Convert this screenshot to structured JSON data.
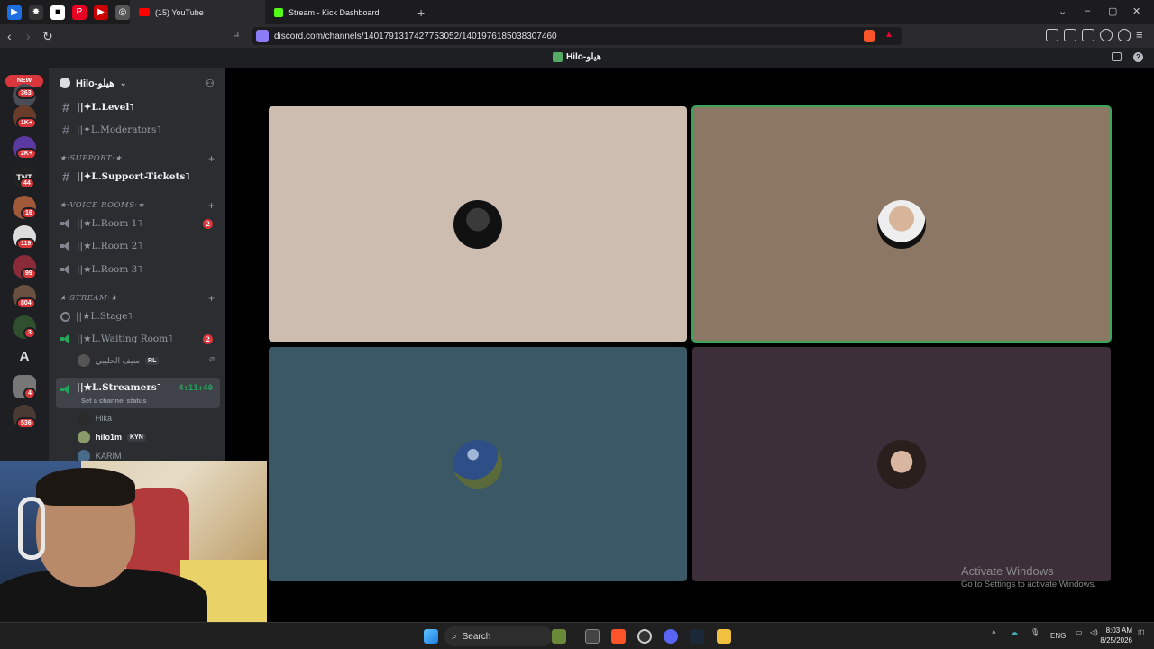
{
  "browser": {
    "tabs": [
      {
        "label": "(15) YouTube",
        "favicon": "youtube-icon",
        "active": true
      },
      {
        "label": "Stream - Kick Dashboard",
        "favicon": "kick-icon",
        "active": false
      }
    ],
    "new_tab": "+",
    "url": "discord.com/channels/1401791317427753052/1401976185038307460"
  },
  "discord": {
    "window_title": "Hilo-هيلو",
    "rail": {
      "new_label": "NEW",
      "badges": [
        "363",
        "1K+",
        "2K+",
        "44",
        "16",
        "119",
        "99",
        "804",
        "3",
        "4",
        "536"
      ]
    },
    "guild_name": "Hilo-هيلو",
    "channels": {
      "level": "||✦L.Level˥",
      "moderators": "||✦L.Moderators˥",
      "support_category": "★·SUPPORT·★",
      "support_tickets": "||✦L.Support-Tickets˥",
      "voice_category": "★·VOICE ROOMS·★",
      "room1": "||★L.Room 1˥",
      "room1_badge": "2",
      "room2": "||★L.Room 2˥",
      "room3": "||★L.Room 3˥",
      "stream_category": "★·STREAM·★",
      "stage": "||★L.Stage˥",
      "waiting_room": "||★L.Waiting Room˥",
      "waiting_badge": "2",
      "waiting_user": "سيف الحليبي",
      "waiting_user_tag": "RL",
      "streamers": "||★L.Streamers˥",
      "streamers_timer": "4:11:40",
      "streamers_status": "Set a channel status",
      "voice_users": [
        {
          "name": "Hika",
          "tag": ""
        },
        {
          "name": "hilo1m",
          "tag": "KYN"
        },
        {
          "name": "KARIM",
          "tag": ""
        }
      ]
    }
  },
  "stage_tiles": [
    {
      "color": "#cdbcb0",
      "avatar": "man-in-suit-sunglasses"
    },
    {
      "color": "#8b7763",
      "avatar": "bald-man-suit",
      "speaking": true
    },
    {
      "color": "#3b5866",
      "avatar": "starry-night-painting"
    },
    {
      "color": "#3d2f3a",
      "avatar": "young-man-photo"
    }
  ],
  "watermark": {
    "line1": "Activate Windows",
    "line2": "Go to Settings to activate Windows."
  },
  "taskbar": {
    "search_label": "Search",
    "lang": "ENG",
    "time": "8:03 AM",
    "date": "8/25/2026"
  }
}
